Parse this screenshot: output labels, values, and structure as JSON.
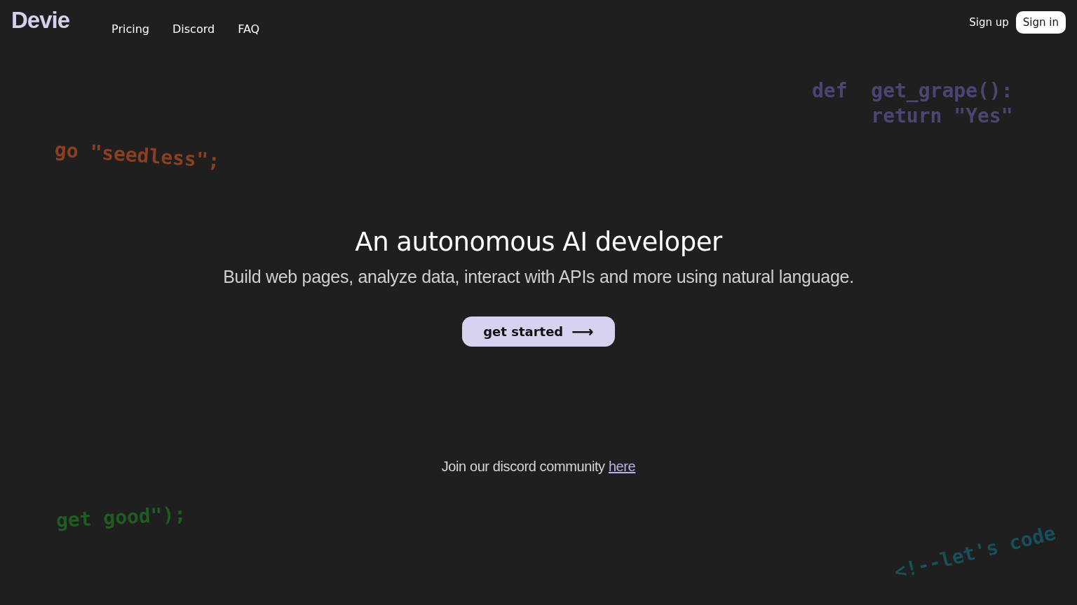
{
  "header": {
    "logo": "Devie",
    "nav": [
      {
        "label": "Pricing"
      },
      {
        "label": "Discord"
      },
      {
        "label": "FAQ"
      }
    ],
    "sign_up": "Sign up",
    "sign_in": "Sign in"
  },
  "hero": {
    "title": "An autonomous AI developer",
    "subtitle": "Build web pages, analyze data, interact with APIs and more using natural language.",
    "cta": "get started",
    "cta_icon": "⟶"
  },
  "community": {
    "text": "Join our discord community",
    "link": "here"
  },
  "code_snippets": [
    {
      "lines": [
        "def  get_grape():",
        "     return \"Yes\""
      ],
      "color": "#4a4672"
    },
    {
      "lines": [
        "go \"seedless\";"
      ],
      "color": "#8a4020"
    },
    {
      "lines": [
        "get good\");"
      ],
      "color": "#1f5c22"
    },
    {
      "lines": [
        "<!--let's code"
      ],
      "color": "#17505a"
    }
  ]
}
